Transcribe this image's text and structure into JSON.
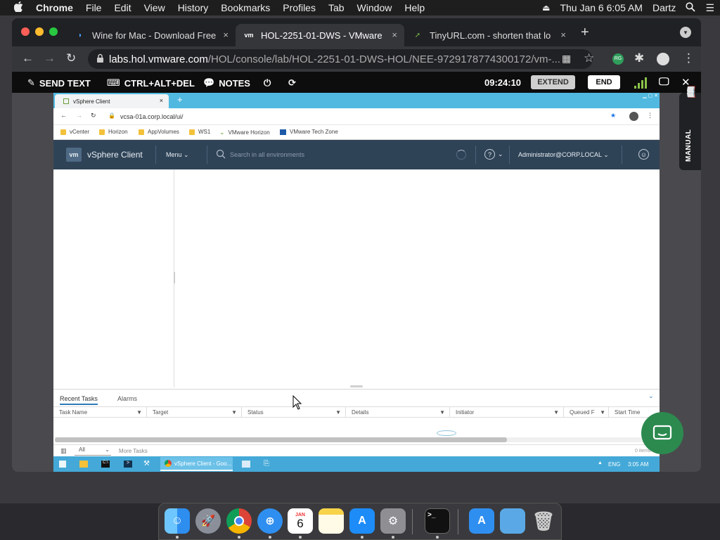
{
  "menubar": {
    "apple": "",
    "app": "Chrome",
    "items": [
      "File",
      "Edit",
      "View",
      "History",
      "Bookmarks",
      "Profiles",
      "Tab",
      "Window",
      "Help"
    ],
    "datetime": "Thu Jan 6  6:05 AM",
    "user": "Dartz"
  },
  "chrome": {
    "tabs": [
      {
        "title": "Wine for Mac - Download Free",
        "close": "×"
      },
      {
        "title": "HOL-2251-01-DWS - VMware",
        "close": "×"
      },
      {
        "title": "TinyURL.com - shorten that lo",
        "close": "×"
      }
    ],
    "newtab": "+",
    "url": "labs.hol.vmware.com/HOL/console/lab/HOL-2251-01-DWS-HOL/NEE-9729178774300172/vm-...",
    "url_domain": "labs.hol.vmware.com",
    "url_path": "/HOL/console/lab/HOL-2251-01-DWS-HOL/NEE-9729178774300172/vm-...",
    "ext_badge": "RG"
  },
  "holbar": {
    "send_text": "SEND TEXT",
    "ctrl": "CTRL+ALT+DEL",
    "notes": "NOTES",
    "timer": "09:24:10",
    "extend": "EXTEND",
    "end": "END",
    "manual": "MANUAL"
  },
  "vm": {
    "tab_title": "vSphere Client",
    "url": "vcsa-01a.corp.local/ui/",
    "bookmarks": [
      "vCenter",
      "Horizon",
      "AppVolumes",
      "WS1",
      "VMware Horizon",
      "VMware Tech Zone"
    ],
    "vsphere": {
      "logo": "vm",
      "title": "vSphere Client",
      "menu": "Menu",
      "search_placeholder": "Search in all environments",
      "help": "?",
      "user": "Administrator@CORP.LOCAL"
    },
    "tasks": {
      "tabs": [
        "Recent Tasks",
        "Alarms"
      ],
      "columns": [
        "Task Name",
        "Target",
        "Status",
        "Details",
        "Initiator",
        "Queued F",
        "Start Time"
      ],
      "filter": "All",
      "more": "More Tasks",
      "count": "0 items"
    },
    "taskbar": {
      "app": "vSphere Client - Goo...",
      "lang": "ENG",
      "time": "3:05 AM"
    }
  },
  "dock": {
    "calendar_month": "JAN",
    "calendar_day": "6"
  },
  "colors": {
    "vsphere_header": "#2f4357",
    "taskbar": "#44a9d8",
    "accent": "#51b9e0"
  }
}
